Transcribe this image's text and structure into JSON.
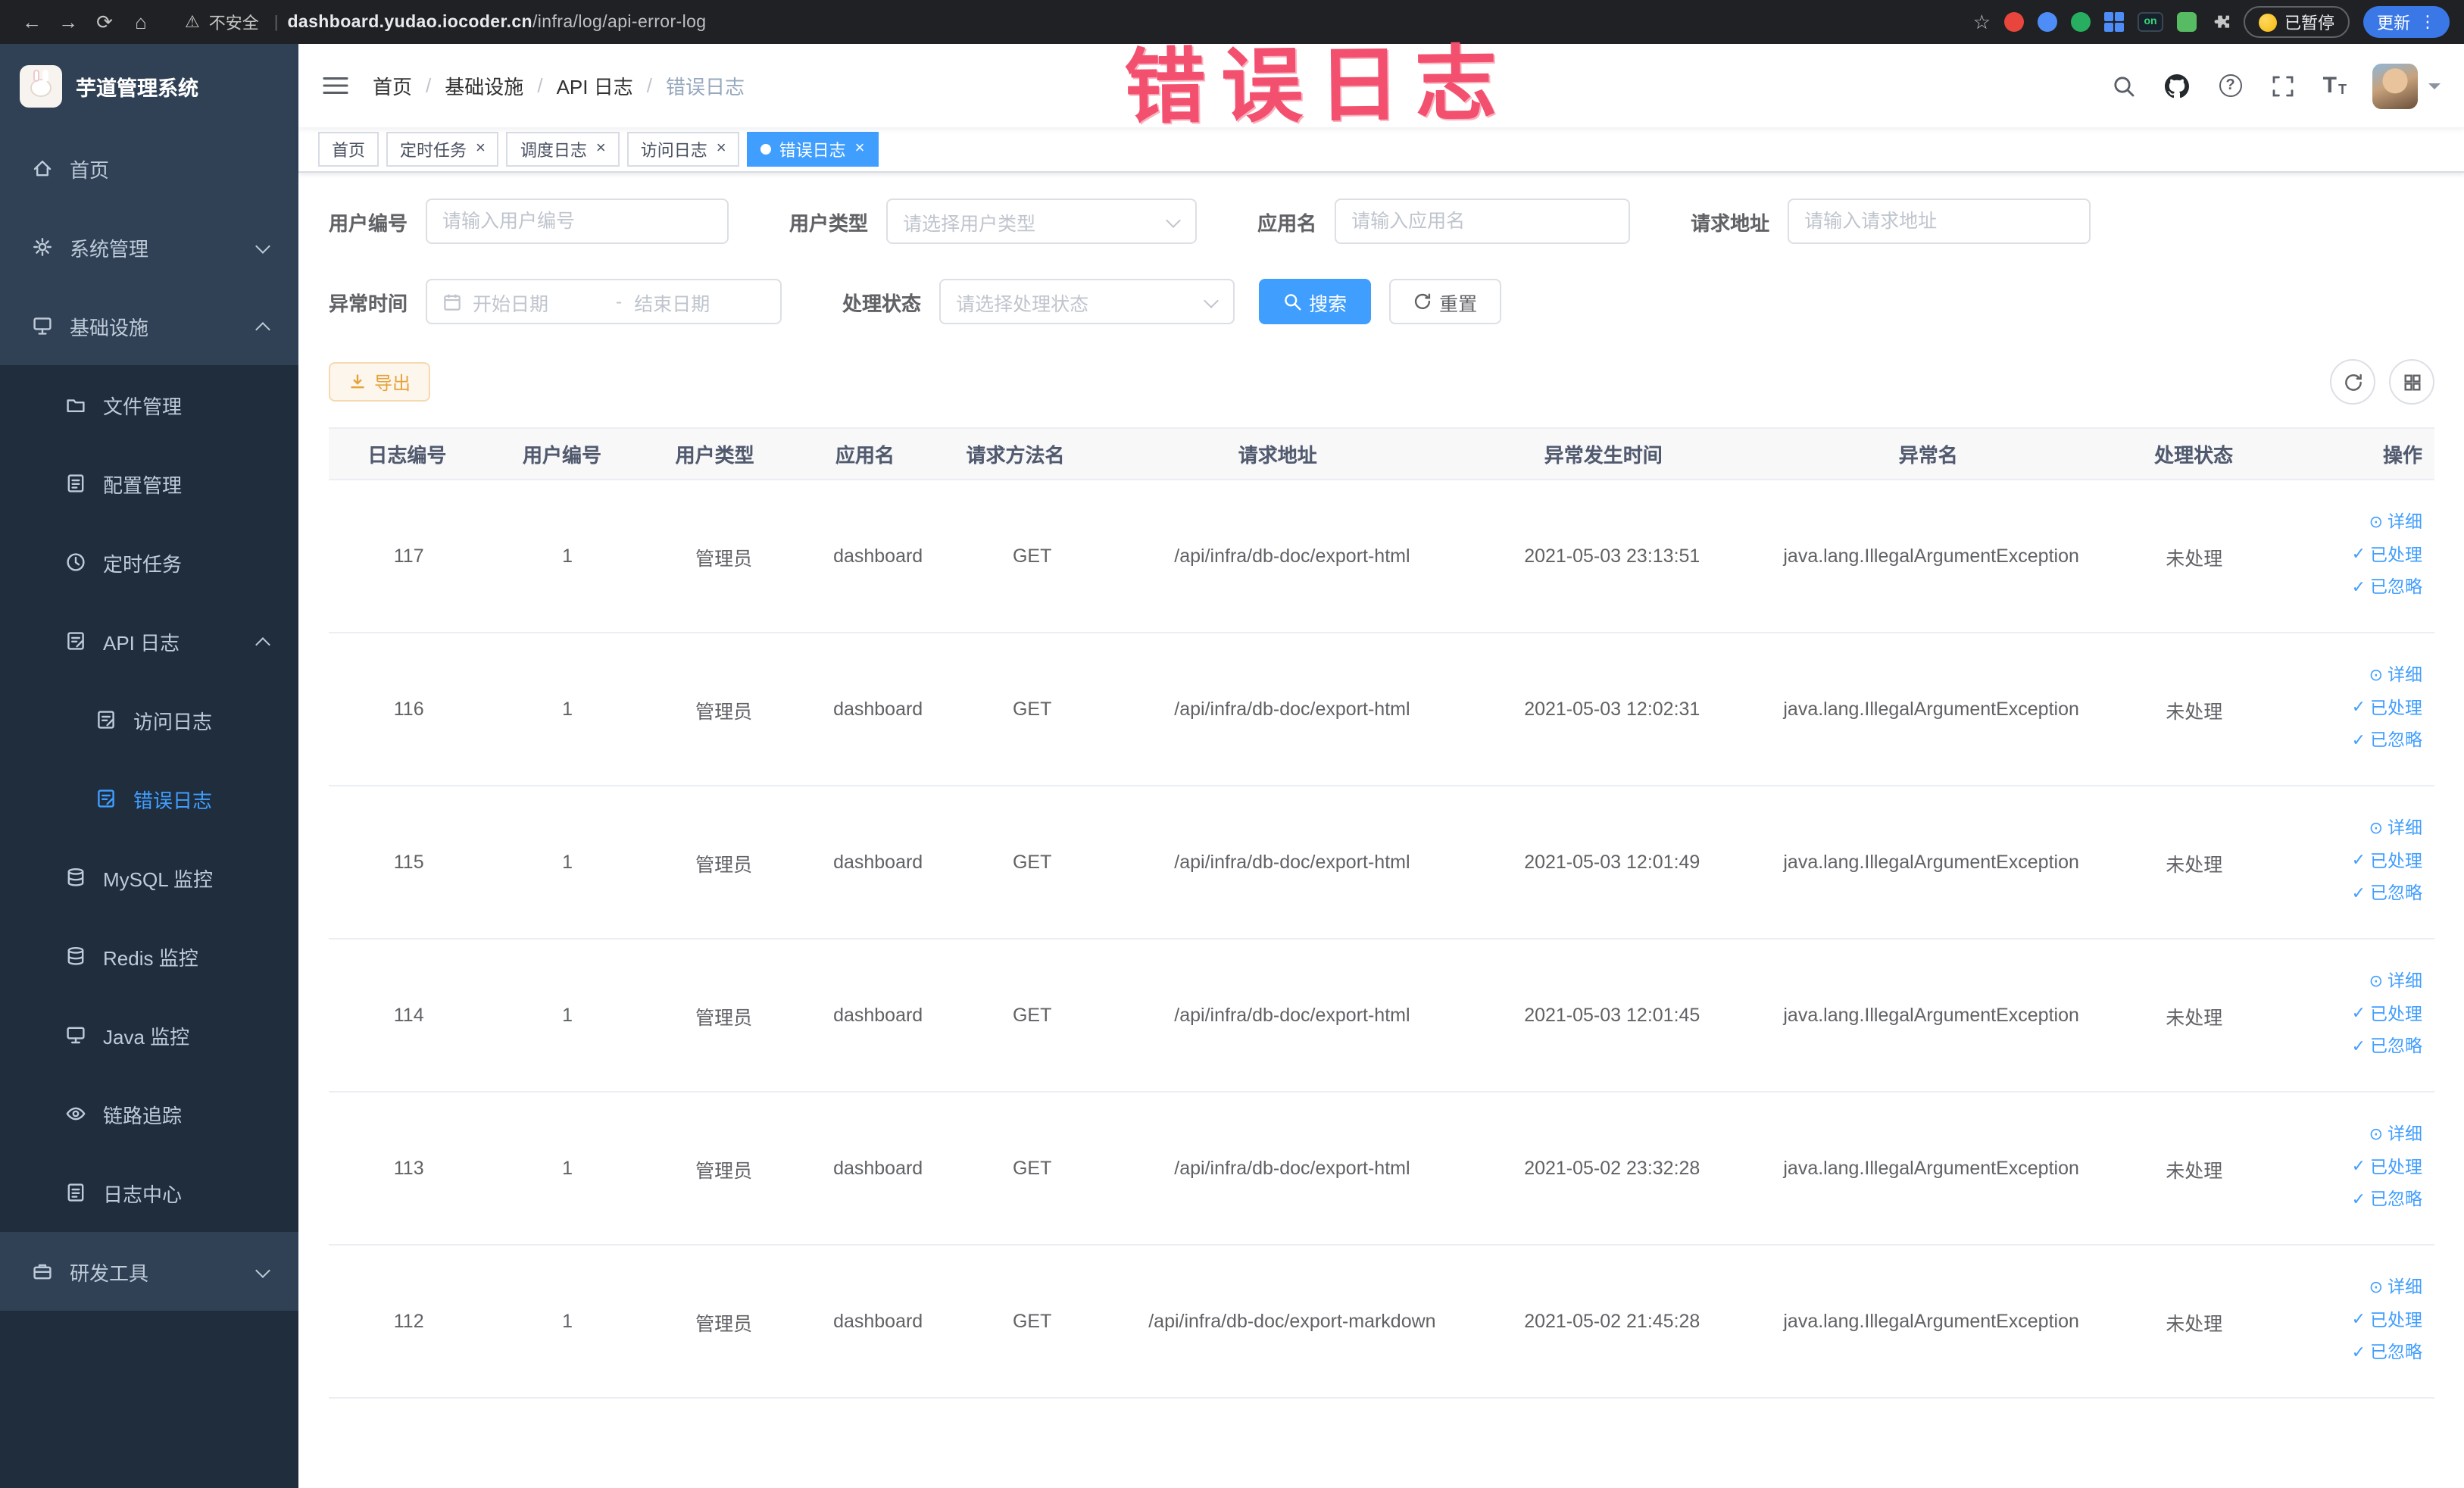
{
  "browser": {
    "security_warning": "不安全",
    "url_domain": "dashboard.yudao.iocoder.cn",
    "url_path": "/infra/log/api-error-log",
    "extension_on_badge": "on",
    "paused_button": "已暂停",
    "update_button": "更新"
  },
  "icons": {
    "back": "←",
    "forward": "→",
    "reload": "⟳",
    "home": "⌂",
    "warning": "⚠",
    "pipe": "|",
    "star": "☆",
    "kebab": "⋮",
    "close": "×",
    "check": "✓",
    "eye": "⊙",
    "question": "?",
    "size": "T"
  },
  "sidebar": {
    "logo_title": "芋道管理系统",
    "items": [
      {
        "label": "首页"
      },
      {
        "label": "系统管理"
      },
      {
        "label": "基础设施"
      },
      {
        "label": "文件管理"
      },
      {
        "label": "配置管理"
      },
      {
        "label": "定时任务"
      },
      {
        "label": "API 日志"
      },
      {
        "label": "访问日志"
      },
      {
        "label": "错误日志"
      },
      {
        "label": "MySQL 监控"
      },
      {
        "label": "Redis 监控"
      },
      {
        "label": "Java 监控"
      },
      {
        "label": "链路追踪"
      },
      {
        "label": "日志中心"
      },
      {
        "label": "研发工具"
      }
    ]
  },
  "header": {
    "breadcrumb": [
      {
        "label": "首页"
      },
      {
        "label": "基础设施"
      },
      {
        "label": "API 日志"
      },
      {
        "label": "错误日志"
      }
    ],
    "breadcrumb_separator": "/"
  },
  "annotation": "错误日志",
  "tags": [
    {
      "label": "首页"
    },
    {
      "label": "定时任务"
    },
    {
      "label": "调度日志"
    },
    {
      "label": "访问日志"
    },
    {
      "label": "错误日志"
    }
  ],
  "filters": {
    "user_id_label": "用户编号",
    "user_id_placeholder": "请输入用户编号",
    "user_type_label": "用户类型",
    "user_type_placeholder": "请选择用户类型",
    "app_name_label": "应用名",
    "app_name_placeholder": "请输入应用名",
    "request_url_label": "请求地址",
    "request_url_placeholder": "请输入请求地址",
    "exception_time_label": "异常时间",
    "date_start_placeholder": "开始日期",
    "date_separator": "-",
    "date_end_placeholder": "结束日期",
    "process_status_label": "处理状态",
    "process_status_placeholder": "请选择处理状态",
    "search_button": "搜索",
    "reset_button": "重置"
  },
  "toolbar": {
    "export_button": "导出"
  },
  "table": {
    "headers": [
      "日志编号",
      "用户编号",
      "用户类型",
      "应用名",
      "请求方法名",
      "请求地址",
      "异常发生时间",
      "异常名",
      "处理状态",
      "操作"
    ],
    "action_detail": "详细",
    "action_processed": "已处理",
    "action_ignored": "已忽略",
    "rows": [
      {
        "id": "117",
        "user_id": "1",
        "user_type": "管理员",
        "app": "dashboard",
        "method": "GET",
        "url": "/api/infra/db-doc/export-html",
        "time": "2021-05-03 23:13:51",
        "exception": "java.lang.IllegalArgumentException",
        "status": "未处理"
      },
      {
        "id": "116",
        "user_id": "1",
        "user_type": "管理员",
        "app": "dashboard",
        "method": "GET",
        "url": "/api/infra/db-doc/export-html",
        "time": "2021-05-03 12:02:31",
        "exception": "java.lang.IllegalArgumentException",
        "status": "未处理"
      },
      {
        "id": "115",
        "user_id": "1",
        "user_type": "管理员",
        "app": "dashboard",
        "method": "GET",
        "url": "/api/infra/db-doc/export-html",
        "time": "2021-05-03 12:01:49",
        "exception": "java.lang.IllegalArgumentException",
        "status": "未处理"
      },
      {
        "id": "114",
        "user_id": "1",
        "user_type": "管理员",
        "app": "dashboard",
        "method": "GET",
        "url": "/api/infra/db-doc/export-html",
        "time": "2021-05-03 12:01:45",
        "exception": "java.lang.IllegalArgumentException",
        "status": "未处理"
      },
      {
        "id": "113",
        "user_id": "1",
        "user_type": "管理员",
        "app": "dashboard",
        "method": "GET",
        "url": "/api/infra/db-doc/export-html",
        "time": "2021-05-02 23:32:28",
        "exception": "java.lang.IllegalArgumentException",
        "status": "未处理"
      },
      {
        "id": "112",
        "user_id": "1",
        "user_type": "管理员",
        "app": "dashboard",
        "method": "GET",
        "url": "/api/infra/db-doc/export-markdown",
        "time": "2021-05-02 21:45:28",
        "exception": "java.lang.IllegalArgumentException",
        "status": "未处理"
      }
    ]
  },
  "colors": {
    "accent": "#409eff",
    "sidebar_bg": "#304156",
    "sidebar_sub_bg": "#1f2d3d",
    "annotation_pink": "#f2506e",
    "export_orange": "#e6a23c",
    "chrome_bg": "#202124"
  }
}
